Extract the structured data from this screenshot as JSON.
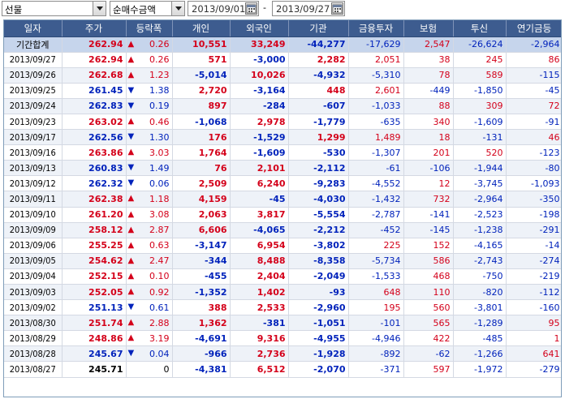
{
  "toolbar": {
    "market_select": "선물",
    "metric_select": "순매수금액",
    "date_from": "2013/09/01",
    "date_sep": "-",
    "date_to": "2013/09/27"
  },
  "columns": [
    "일자",
    "주가",
    "등락폭",
    "개인",
    "외국인",
    "기관",
    "금융투자",
    "보험",
    "투신",
    "연기금등"
  ],
  "summary": {
    "label": "기간합계",
    "price": "262.94",
    "dir": "up",
    "change": "0.26",
    "individual": "10,551",
    "foreign": "33,249",
    "institution": "-44,277",
    "fin_invest": "-17,629",
    "insurance": "2,547",
    "trust": "-26,624",
    "pension": "-2,964"
  },
  "rows": [
    {
      "date": "2013/09/27",
      "price": "262.94",
      "dir": "up",
      "change": "0.26",
      "individual": "571",
      "foreign": "-3,000",
      "institution": "2,282",
      "fin_invest": "2,051",
      "insurance": "38",
      "trust": "245",
      "pension": "86"
    },
    {
      "date": "2013/09/26",
      "price": "262.68",
      "dir": "up",
      "change": "1.23",
      "individual": "-5,014",
      "foreign": "10,026",
      "institution": "-4,932",
      "fin_invest": "-5,310",
      "insurance": "78",
      "trust": "589",
      "pension": "-115"
    },
    {
      "date": "2013/09/25",
      "price": "261.45",
      "dir": "down",
      "change": "1.38",
      "individual": "2,720",
      "foreign": "-3,164",
      "institution": "448",
      "fin_invest": "2,601",
      "insurance": "-449",
      "trust": "-1,850",
      "pension": "-45"
    },
    {
      "date": "2013/09/24",
      "price": "262.83",
      "dir": "down",
      "change": "0.19",
      "individual": "897",
      "foreign": "-284",
      "institution": "-607",
      "fin_invest": "-1,033",
      "insurance": "88",
      "trust": "309",
      "pension": "72"
    },
    {
      "date": "2013/09/23",
      "price": "263.02",
      "dir": "up",
      "change": "0.46",
      "individual": "-1,068",
      "foreign": "2,978",
      "institution": "-1,779",
      "fin_invest": "-635",
      "insurance": "340",
      "trust": "-1,609",
      "pension": "-91"
    },
    {
      "date": "2013/09/17",
      "price": "262.56",
      "dir": "down",
      "change": "1.30",
      "individual": "176",
      "foreign": "-1,529",
      "institution": "1,299",
      "fin_invest": "1,489",
      "insurance": "18",
      "trust": "-131",
      "pension": "46"
    },
    {
      "date": "2013/09/16",
      "price": "263.86",
      "dir": "up",
      "change": "3.03",
      "individual": "1,764",
      "foreign": "-1,609",
      "institution": "-530",
      "fin_invest": "-1,307",
      "insurance": "201",
      "trust": "520",
      "pension": "-123"
    },
    {
      "date": "2013/09/13",
      "price": "260.83",
      "dir": "down",
      "change": "1.49",
      "individual": "76",
      "foreign": "2,101",
      "institution": "-2,112",
      "fin_invest": "-61",
      "insurance": "-106",
      "trust": "-1,944",
      "pension": "-80"
    },
    {
      "date": "2013/09/12",
      "price": "262.32",
      "dir": "down",
      "change": "0.06",
      "individual": "2,509",
      "foreign": "6,240",
      "institution": "-9,283",
      "fin_invest": "-4,552",
      "insurance": "12",
      "trust": "-3,745",
      "pension": "-1,093"
    },
    {
      "date": "2013/09/11",
      "price": "262.38",
      "dir": "up",
      "change": "1.18",
      "individual": "4,159",
      "foreign": "-45",
      "institution": "-4,030",
      "fin_invest": "-1,432",
      "insurance": "732",
      "trust": "-2,964",
      "pension": "-350"
    },
    {
      "date": "2013/09/10",
      "price": "261.20",
      "dir": "up",
      "change": "3.08",
      "individual": "2,063",
      "foreign": "3,817",
      "institution": "-5,554",
      "fin_invest": "-2,787",
      "insurance": "-141",
      "trust": "-2,523",
      "pension": "-198"
    },
    {
      "date": "2013/09/09",
      "price": "258.12",
      "dir": "up",
      "change": "2.87",
      "individual": "6,606",
      "foreign": "-4,065",
      "institution": "-2,212",
      "fin_invest": "-452",
      "insurance": "-145",
      "trust": "-1,238",
      "pension": "-291"
    },
    {
      "date": "2013/09/06",
      "price": "255.25",
      "dir": "up",
      "change": "0.63",
      "individual": "-3,147",
      "foreign": "6,954",
      "institution": "-3,802",
      "fin_invest": "225",
      "insurance": "152",
      "trust": "-4,165",
      "pension": "-14"
    },
    {
      "date": "2013/09/05",
      "price": "254.62",
      "dir": "up",
      "change": "2.47",
      "individual": "-344",
      "foreign": "8,488",
      "institution": "-8,358",
      "fin_invest": "-5,734",
      "insurance": "586",
      "trust": "-2,743",
      "pension": "-274"
    },
    {
      "date": "2013/09/04",
      "price": "252.15",
      "dir": "up",
      "change": "0.10",
      "individual": "-455",
      "foreign": "2,404",
      "institution": "-2,049",
      "fin_invest": "-1,533",
      "insurance": "468",
      "trust": "-750",
      "pension": "-219"
    },
    {
      "date": "2013/09/03",
      "price": "252.05",
      "dir": "up",
      "change": "0.92",
      "individual": "-1,352",
      "foreign": "1,402",
      "institution": "-93",
      "fin_invest": "648",
      "insurance": "110",
      "trust": "-820",
      "pension": "-112"
    },
    {
      "date": "2013/09/02",
      "price": "251.13",
      "dir": "down",
      "change": "0.61",
      "individual": "388",
      "foreign": "2,533",
      "institution": "-2,960",
      "fin_invest": "195",
      "insurance": "560",
      "trust": "-3,801",
      "pension": "-160"
    },
    {
      "date": "2013/08/30",
      "price": "251.74",
      "dir": "up",
      "change": "2.88",
      "individual": "1,362",
      "foreign": "-381",
      "institution": "-1,051",
      "fin_invest": "-101",
      "insurance": "565",
      "trust": "-1,289",
      "pension": "95"
    },
    {
      "date": "2013/08/29",
      "price": "248.86",
      "dir": "up",
      "change": "3.19",
      "individual": "-4,691",
      "foreign": "9,316",
      "institution": "-4,955",
      "fin_invest": "-4,946",
      "insurance": "422",
      "trust": "-485",
      "pension": "1"
    },
    {
      "date": "2013/08/28",
      "price": "245.67",
      "dir": "down",
      "change": "0.04",
      "individual": "-966",
      "foreign": "2,736",
      "institution": "-1,928",
      "fin_invest": "-892",
      "insurance": "-62",
      "trust": "-1,266",
      "pension": "641"
    },
    {
      "date": "2013/08/27",
      "price": "245.71",
      "dir": "flat",
      "change": "0",
      "individual": "-4,381",
      "foreign": "6,512",
      "institution": "-2,070",
      "fin_invest": "-371",
      "insurance": "597",
      "trust": "-1,972",
      "pension": "-279"
    }
  ],
  "colors": {
    "up": "#d4001a",
    "down": "#0022bb",
    "header_bg": "#3d5c8f",
    "summary_bg": "#c6d5ec",
    "alt_row_bg": "#eef2f8"
  },
  "icons": {
    "up": "up-arrow-icon",
    "down": "down-arrow-icon",
    "calendar": "calendar-icon",
    "dropdown": "chevron-down-icon"
  }
}
